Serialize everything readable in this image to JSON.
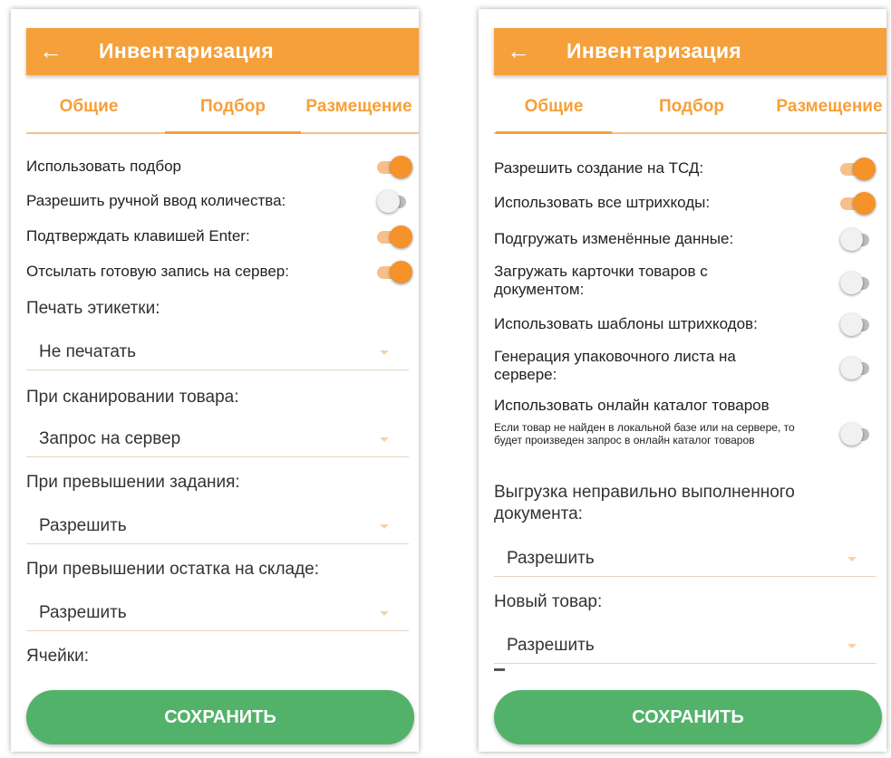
{
  "left": {
    "title": "Инвентаризация",
    "tabs": [
      "Общие",
      "Подбор",
      "Размещение"
    ],
    "toggles": [
      {
        "label": "Использовать подбор",
        "on": true
      },
      {
        "label": "Разрешить ручной ввод количества:",
        "on": false
      },
      {
        "label": "Подтверждать клавишей Enter:",
        "on": true
      },
      {
        "label": "Отсылать готовую запись на сервер:",
        "on": true
      }
    ],
    "selects": [
      {
        "label": "Печать этикетки:",
        "value": "Не печатать"
      },
      {
        "label": "При сканировании товара:",
        "value": "Запрос на сервер"
      },
      {
        "label": "При превышении задания:",
        "value": "Разрешить"
      },
      {
        "label": "При превышении остатка на складе:",
        "value": "Разрешить"
      }
    ],
    "cells_label": "Ячейки:",
    "save_label": "СОХРАНИТЬ"
  },
  "right": {
    "title": "Инвентаризация",
    "tabs": [
      "Общие",
      "Подбор",
      "Размещение"
    ],
    "toggles": [
      {
        "label": "Разрешить создание на ТСД:",
        "on": true
      },
      {
        "label": "Использовать все штрихкоды:",
        "on": true
      },
      {
        "label": "Подгружать изменённые данные:",
        "on": false
      },
      {
        "label": "Загружать карточки товаров с документом:",
        "on": false
      },
      {
        "label": "Использовать шаблоны штрихкодов:",
        "on": false
      },
      {
        "label": "Генерация упаковочного листа на сервере:",
        "on": false
      },
      {
        "label": "Использовать онлайн каталог товаров",
        "on": false
      }
    ],
    "online_hint": "Если товар не найден в локальной базе или на сервере, то будет произведен запрос в онлайн каталог товаров",
    "selects": [
      {
        "label": "Выгрузка неправильно выполненного документа:",
        "value": "Разрешить"
      },
      {
        "label": "Новый товар:",
        "value": "Разрешить"
      }
    ],
    "save_label": "СОХРАНИТЬ"
  },
  "colors": {
    "accent": "#f5a03a",
    "save": "#52b26a",
    "toggle_on": "#f5922a",
    "toggle_off": "#bdbdbd"
  }
}
